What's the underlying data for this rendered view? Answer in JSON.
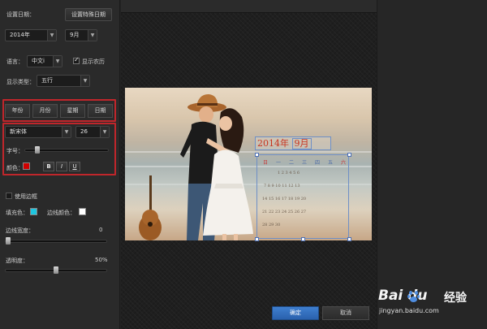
{
  "settings": {
    "set_date_label": "设置日期：",
    "set_special_date_button": "设置特殊日期",
    "year_value": "2014年",
    "month_value": "9月",
    "language_label": "语言：",
    "language_value": "中文i",
    "lunar_checkbox_label": "显示农历",
    "display_type_label": "显示类型：",
    "display_type_value": "五行"
  },
  "tabs": [
    "年份",
    "月份",
    "星期",
    "日期"
  ],
  "font_panel": {
    "font_value": "新宋体",
    "size_value": "26",
    "font_size_label": "字号：",
    "font_size_level": 0.3,
    "color_label": "颜色：",
    "color_value": "#d00000",
    "bold_label": "B",
    "italic_label": "I",
    "underline_label": "U"
  },
  "border_panel": {
    "use_border_label": "使用边框",
    "fill_color_label": "填充色：",
    "fill_color_value": "#1ec6e0",
    "border_color_label": "边线颜色：",
    "border_color_value": "#ffffff",
    "border_width_label": "边线宽度：",
    "border_width_value": "0",
    "transparency_label": "透明度：",
    "transparency_value": "50%"
  },
  "calendar_preview": {
    "year_text": "2014年",
    "month_text": "9月",
    "weekdays": [
      "日",
      "一",
      "二",
      "三",
      "四",
      "五",
      "六"
    ],
    "rows": [
      "",
      "1    2    3    4    5    6",
      "7    8    9   10   11  12  13",
      "14  15  16  17  18  19  20",
      "21  22  23  24  25  26  27",
      "28  29  30"
    ]
  },
  "actions": {
    "ok_label": "确定",
    "cancel_label": "取消"
  },
  "watermark": {
    "logo_text": "Bai  du",
    "cn_text": "经验",
    "url": "jingyan.baidu.com"
  },
  "colors": {
    "highlight_border": "#c0262b",
    "primary_button": "#3a78c9"
  }
}
